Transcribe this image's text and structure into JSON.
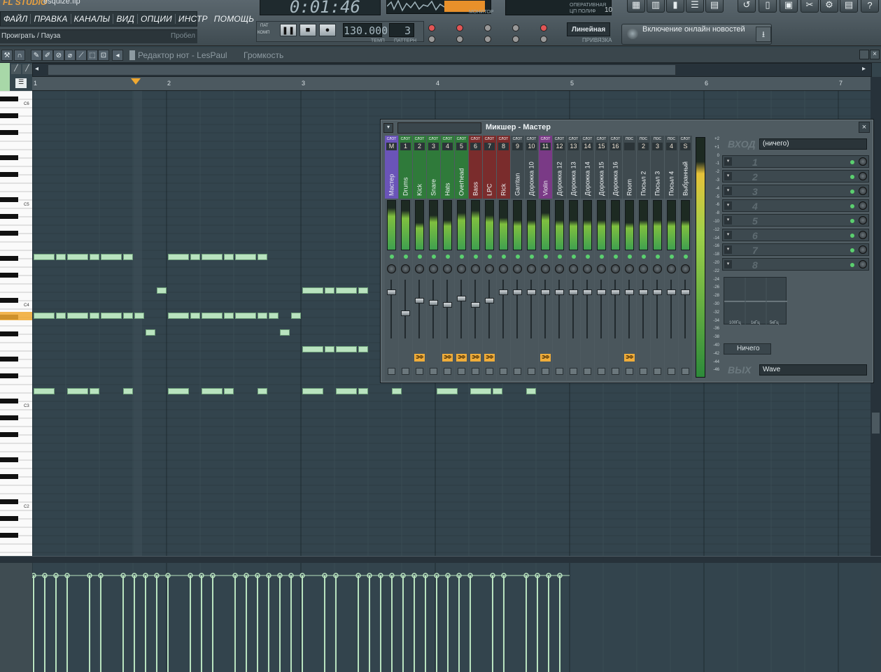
{
  "app": {
    "logo": "FL STUDIO",
    "file_name": "esquize.flp"
  },
  "menu": [
    "ФАЙЛ",
    "ПРАВКА",
    "КАНАЛЫ",
    "ВИД",
    "ОПЦИИ",
    "ИНСТР",
    "ПОМОЩЬ"
  ],
  "hint": {
    "text": "Проиграть / Пауза",
    "key": "Пробел"
  },
  "transport": {
    "time": "0:01:46",
    "tempo": "130.000",
    "tempo_label": "ТЕМП",
    "pattern": "3",
    "pattern_label": "ПАТТЕРН",
    "monitor_label": "МОНИТОР",
    "cpu_label": "ОПЕРАТИВНАЯ",
    "poly_label": "ЦП ПОЛИФ",
    "poly_value": "10",
    "pat_label": "ПАТ",
    "song_label": "КОМП"
  },
  "snap": {
    "value": "Линейная",
    "label": "ПРИВЯЗКА"
  },
  "news": {
    "text": "Включение онлайн новостей"
  },
  "piano_roll": {
    "title": "Редактор нот - LesPaul",
    "param": "Громкость",
    "bars": [
      "1",
      "2",
      "3",
      "4",
      "5",
      "6",
      "7"
    ],
    "octaves": [
      "C6",
      "C5",
      "C4",
      "C3",
      "C2"
    ]
  },
  "mixer": {
    "title": "Микшер - Мастер",
    "channels": [
      {
        "num": "M",
        "name": "Мастер",
        "color": "#6a54b8",
        "fx": false,
        "level": 0.85,
        "fader": 0.1
      },
      {
        "num": "1",
        "name": "Drums",
        "color": "#2f7a3a",
        "fx": false,
        "level": 0.8,
        "fader": 0.6
      },
      {
        "num": "2",
        "name": "Kick",
        "color": "#2f7a3a",
        "fx": true,
        "level": 0.55,
        "fader": 0.3
      },
      {
        "num": "3",
        "name": "Snare",
        "color": "#2f7a3a",
        "fx": false,
        "level": 0.7,
        "fader": 0.35
      },
      {
        "num": "4",
        "name": "Hats",
        "color": "#2f7a3a",
        "fx": true,
        "level": 0.6,
        "fader": 0.4
      },
      {
        "num": "5",
        "name": "Overhead",
        "color": "#2f7a3a",
        "fx": true,
        "level": 0.75,
        "fader": 0.25
      },
      {
        "num": "6",
        "name": "Bass",
        "color": "#7a2c2c",
        "fx": true,
        "level": 0.8,
        "fader": 0.4
      },
      {
        "num": "7",
        "name": "LPC",
        "color": "#7a2c2c",
        "fx": true,
        "level": 0.7,
        "fader": 0.3
      },
      {
        "num": "8",
        "name": "Rick",
        "color": "#7a2c2c",
        "fx": false,
        "level": 0.65,
        "fader": 0.1
      },
      {
        "num": "9",
        "name": "Garritan",
        "color": "#3f4a4f",
        "fx": false,
        "level": 0.6,
        "fader": 0.1
      },
      {
        "num": "10",
        "name": "Дорожка 10",
        "color": "#3f4a4f",
        "fx": false,
        "level": 0.6,
        "fader": 0.1
      },
      {
        "num": "11",
        "name": "Violin",
        "color": "#7a3a86",
        "fx": true,
        "level": 0.75,
        "fader": 0.1
      },
      {
        "num": "12",
        "name": "Дорожка 12",
        "color": "#3f4a4f",
        "fx": false,
        "level": 0.6,
        "fader": 0.1
      },
      {
        "num": "13",
        "name": "Дорожка 13",
        "color": "#3f4a4f",
        "fx": false,
        "level": 0.6,
        "fader": 0.1
      },
      {
        "num": "14",
        "name": "Дорожка 14",
        "color": "#3f4a4f",
        "fx": false,
        "level": 0.6,
        "fader": 0.1
      },
      {
        "num": "15",
        "name": "Дорожка 15",
        "color": "#3f4a4f",
        "fx": false,
        "level": 0.6,
        "fader": 0.1
      },
      {
        "num": "16",
        "name": "Дорожка 16",
        "color": "#3f4a4f",
        "fx": false,
        "level": 0.6,
        "fader": 0.1
      },
      {
        "num": "",
        "name": "Room",
        "color": "#3f4a4f",
        "fx": true,
        "level": 0.55,
        "fader": 0.1
      },
      {
        "num": "2",
        "name": "Посыл 2",
        "color": "#3f4a4f",
        "fx": false,
        "level": 0.6,
        "fader": 0.1
      },
      {
        "num": "3",
        "name": "Посыл 3",
        "color": "#3f4a4f",
        "fx": false,
        "level": 0.6,
        "fader": 0.1
      },
      {
        "num": "4",
        "name": "Посыл 4",
        "color": "#3f4a4f",
        "fx": false,
        "level": 0.6,
        "fader": 0.1
      },
      {
        "num": "S",
        "name": "Выбранный",
        "color": "#3f4a4f",
        "fx": false,
        "level": 0.6,
        "fader": 0.1
      }
    ],
    "slot_prefix": "СЛОТ",
    "send_prefix": "ПОС",
    "fx_label": "ЭФ",
    "in_label": "ВХОД",
    "in_value": "(ничего)",
    "slots": [
      "1",
      "2",
      "3",
      "4",
      "5",
      "6",
      "7",
      "8"
    ],
    "eq_labels": [
      "100Гц",
      "1кГц",
      "5кГц"
    ],
    "route": "Ничего",
    "out_label": "ВЫХ",
    "out_value": "Wave",
    "db_scale": [
      "+2",
      "+1",
      "0",
      "-1",
      "-2",
      "-3",
      "-4",
      "-5",
      "-6",
      "-8",
      "-10",
      "-12",
      "-14",
      "-16",
      "-18",
      "-20",
      "-22",
      "-24",
      "-26",
      "-28",
      "-30",
      "-32",
      "-34",
      "-36",
      "-38",
      "-40",
      "-42",
      "-44",
      "-46"
    ]
  },
  "icons": [
    "pause-icon",
    "stop-icon",
    "record-icon",
    "pencil-icon",
    "speaker-icon",
    "close-icon",
    "arrow-down-icon"
  ]
}
